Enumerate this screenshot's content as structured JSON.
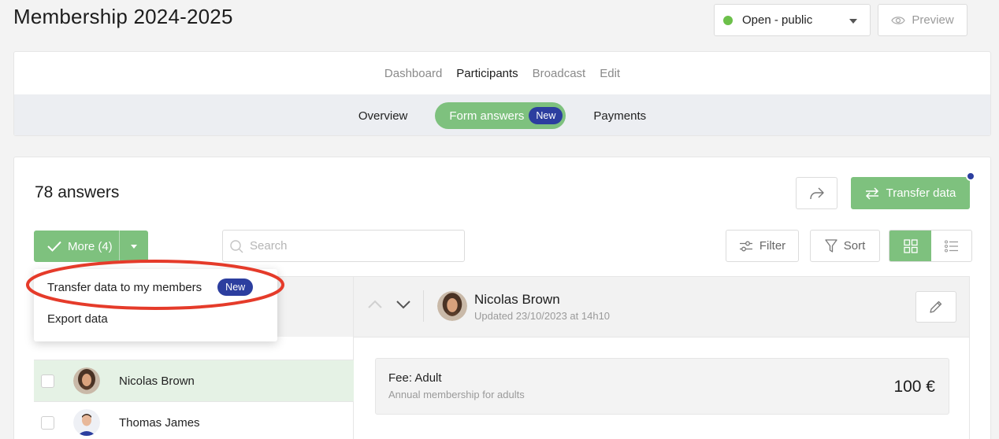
{
  "header": {
    "title": "Membership 2024-2025",
    "status_label": "Open - public",
    "status_color": "#6cc04a",
    "preview_label": "Preview"
  },
  "main_tabs": [
    {
      "label": "Dashboard",
      "active": false
    },
    {
      "label": "Participants",
      "active": true
    },
    {
      "label": "Broadcast",
      "active": false
    },
    {
      "label": "Edit",
      "active": false
    }
  ],
  "sub_tabs": {
    "overview": "Overview",
    "form_answers": "Form answers",
    "form_answers_badge": "New",
    "payments": "Payments"
  },
  "toolbar": {
    "answers_count": "78 answers",
    "transfer_label": "Transfer data",
    "more_label": "More (4)",
    "search_placeholder": "Search",
    "filter_label": "Filter",
    "sort_label": "Sort"
  },
  "dropdown": {
    "items": [
      {
        "label": "Transfer data to my members",
        "badge": "New"
      },
      {
        "label": "Export data"
      }
    ]
  },
  "list": {
    "rows": [
      {
        "name": "Nicolas Brown",
        "selected": true
      },
      {
        "name": "Thomas James",
        "selected": false
      }
    ]
  },
  "detail": {
    "name": "Nicolas Brown",
    "updated": "Updated 23/10/2023 at 14h10",
    "fee_title": "Fee: Adult",
    "fee_description": "Annual membership for adults",
    "fee_amount": "100 €"
  },
  "colors": {
    "accent_green": "#7ec17e",
    "badge_blue": "#2c3e9f",
    "highlight_red": "#e53b2a"
  },
  "icons": [
    "chevron-down-icon",
    "eye-icon",
    "share-icon",
    "transfer-arrows-icon",
    "checkmark-icon",
    "search-icon",
    "filter-sliders-icon",
    "funnel-icon",
    "grid-view-icon",
    "list-view-icon",
    "chevron-up-icon",
    "pencil-icon"
  ]
}
